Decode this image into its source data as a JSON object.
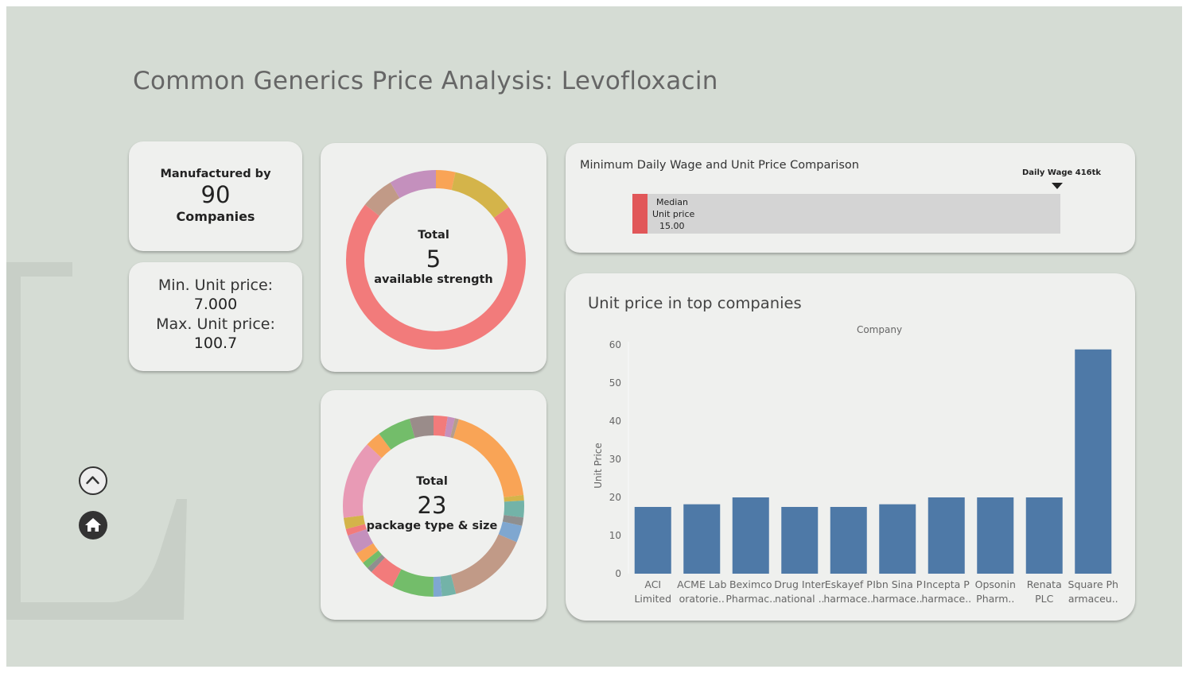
{
  "title": "Common Generics Price Analysis: Levofloxacin",
  "manufactured": {
    "label_top": "Manufactured by",
    "value": "90",
    "label_bottom": "Companies"
  },
  "price_range": {
    "min_label": "Min. Unit price:",
    "min_value": "7.000",
    "max_label": "Max. Unit price:",
    "max_value": "100.7"
  },
  "strength_donut": {
    "label_top": "Total",
    "value": "5",
    "label_bottom": "available strength"
  },
  "package_donut": {
    "label_top": "Total",
    "value": "23",
    "label_bottom": "package type & size"
  },
  "wage_chart": {
    "title": "Minimum Daily Wage and Unit Price Comparison",
    "marker_label": "Daily Wage 416tk",
    "median_line1": "Median",
    "median_line2": "Unit price",
    "median_value": "15.00",
    "median": 15,
    "wage": 416,
    "colors": {
      "median": "#e15759",
      "track": "#d4d4d4"
    }
  },
  "nav": {
    "up_icon": "chevron-up-icon",
    "home_icon": "home-icon"
  },
  "chart_data": [
    {
      "type": "pie",
      "subtype": "donut",
      "slice_share": [
        0.035,
        0.115,
        0.705,
        0.06,
        0.085
      ],
      "colors": [
        "#f9a456",
        "#d4b44a",
        "#f27b7b",
        "#c19a87",
        "#c490bd"
      ]
    },
    {
      "type": "pie",
      "subtype": "donut",
      "slice_share": [
        0.025,
        0.013,
        0.007,
        0.185,
        0.01,
        0.03,
        0.015,
        0.03,
        0.145,
        0.025,
        0.015,
        0.075,
        0.045,
        0.01,
        0.012,
        0.02,
        0.035,
        0.012,
        0.02,
        0.14,
        0.028,
        0.06,
        0.123
      ],
      "colors": [
        "#f27b7b",
        "#c490bd",
        "#b59e8c",
        "#f9a456",
        "#d4b44a",
        "#73b3a8",
        "#8f8f8f",
        "#7fa7d0",
        "#c19a87",
        "#73b3a8",
        "#7fa7d0",
        "#73bd6a",
        "#f27b7b",
        "#8f8f8f",
        "#73bd6a",
        "#f9a456",
        "#c490bd",
        "#f27b7b",
        "#d4b44a",
        "#e89ab5",
        "#f9a456",
        "#73bd6a",
        "#9a8c8a"
      ]
    },
    {
      "type": "bar",
      "title": "Unit price in top companies",
      "xlabel": "Company",
      "ylabel": "Unit Price",
      "ylim": [
        0,
        60
      ],
      "yticks": [
        "0",
        "10",
        "20",
        "30",
        "40",
        "50",
        "60"
      ],
      "grid": false,
      "color": "#4e79a7",
      "categories": [
        [
          "ACI",
          "Limited"
        ],
        [
          "ACME Lab",
          "oratorie.."
        ],
        [
          "Beximco",
          "Pharmac.."
        ],
        [
          "Drug Inter",
          "national .."
        ],
        [
          "Eskayef P",
          "harmace.."
        ],
        [
          "Ibn Sina P",
          "harmace.."
        ],
        [
          "Incepta P",
          "harmace.."
        ],
        [
          "Opsonin",
          "Pharm.."
        ],
        [
          "Renata",
          "PLC"
        ],
        [
          "Square Ph",
          "armaceu.."
        ]
      ],
      "values": [
        17.5,
        18.2,
        20.0,
        17.5,
        17.5,
        18.2,
        20.0,
        20.0,
        20.0,
        58.8
      ]
    }
  ]
}
